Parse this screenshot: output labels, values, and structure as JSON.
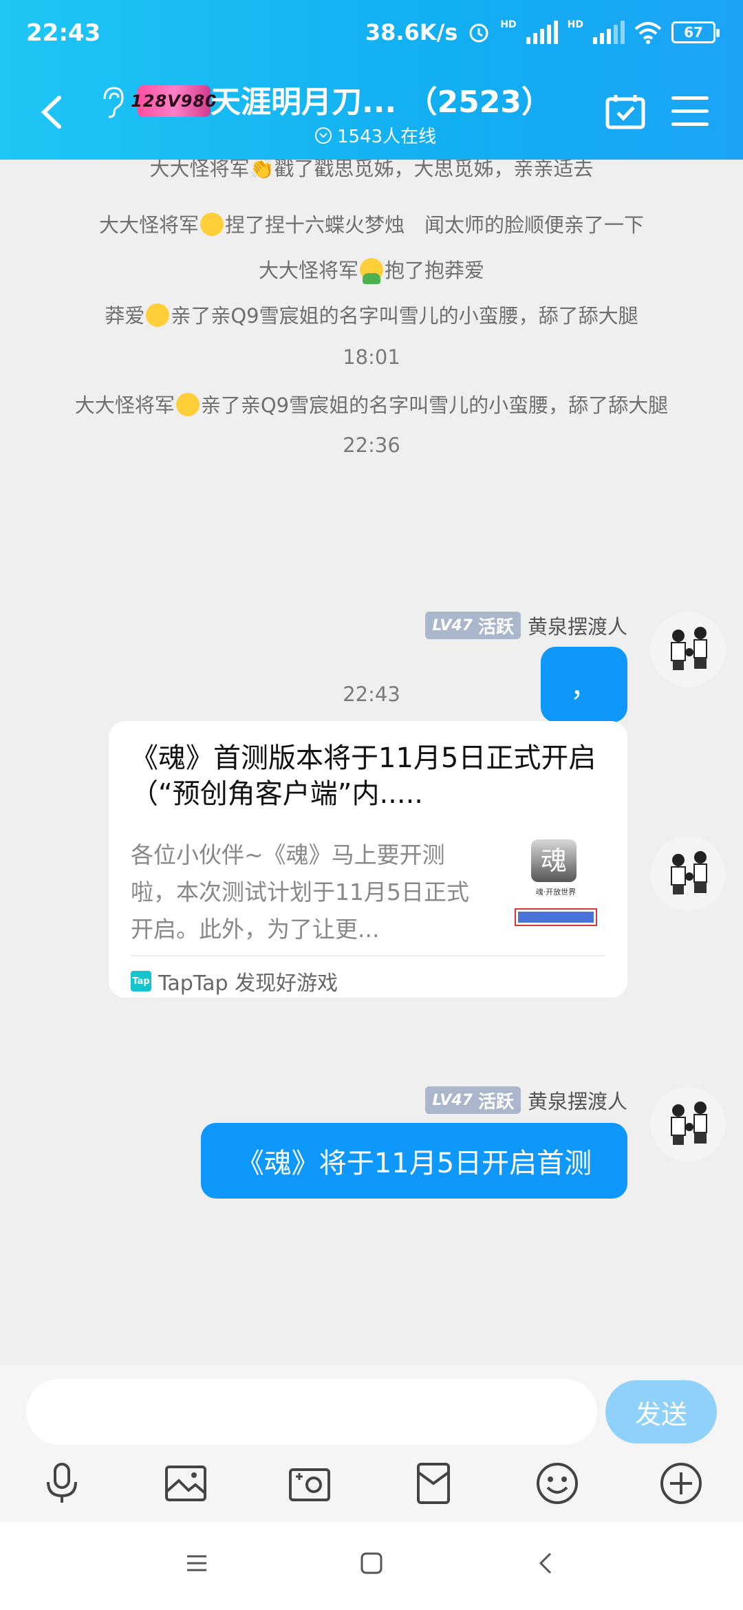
{
  "status": {
    "time": "22:43",
    "net_speed": "38.6K/s",
    "hd1": "HD",
    "hd2": "HD",
    "battery": "67"
  },
  "header": {
    "group_logo_text": "128V980",
    "title": "天涯明月刀...  （2523）",
    "online": "1543人在线"
  },
  "chat": {
    "system_messages": [
      "大大怪将军👏戳了戳思觅姊，大思觅姊，亲亲适去",
      "大大怪将军",
      "捏了捏十六蝶火梦烛　闻太师的脸顺便亲了一下",
      "大大怪将军",
      "抱了抱莽爱",
      "莽爱",
      "亲了亲Q9雪宸姐的名字叫雪儿的小蛮腰，舔了舔大腿",
      "大大怪将军",
      "亲了亲Q9雪宸姐的名字叫雪儿的小蛮腰，舔了舔大腿"
    ],
    "timestamps": [
      "18:01",
      "22:36",
      "22:43"
    ],
    "sender": {
      "level": "LV47",
      "badge": "活跃",
      "name": "黄泉摆渡人"
    },
    "msg1": "，",
    "card": {
      "title": "《魂》首测版本将于11月5日正式开启（“预创角客户端”内.....",
      "desc": "各位小伙伴~《魂》马上要开测啦，本次测试计划于11月5日正式开启。此外，为了让更...",
      "thumb_text": "魂",
      "thumb_caption": "魂·开放世界",
      "source_logo": "Tap",
      "source": "TapTap 发现好游戏"
    },
    "msg3": "《魂》将于11月5日开启首测"
  },
  "input": {
    "placeholder": "",
    "send_label": "发送"
  },
  "toolbar_icons": [
    "microphone-icon",
    "image-icon",
    "camera-icon",
    "red-packet-icon",
    "emoji-icon",
    "plus-icon"
  ],
  "colors": {
    "header": "#12aef2",
    "bubble": "#0f98fb",
    "send_button": "#8fd1fb",
    "level_badge": "#aab6cc"
  }
}
